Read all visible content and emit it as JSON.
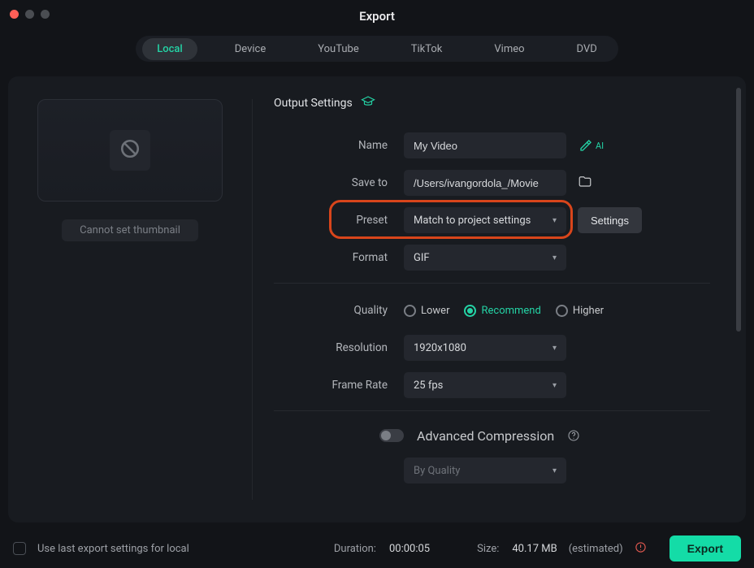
{
  "window": {
    "title": "Export"
  },
  "tabs": {
    "items": [
      {
        "label": "Local",
        "active": true
      },
      {
        "label": "Device"
      },
      {
        "label": "YouTube"
      },
      {
        "label": "TikTok"
      },
      {
        "label": "Vimeo"
      },
      {
        "label": "DVD"
      }
    ]
  },
  "left": {
    "thumbnail_caption": "Cannot set thumbnail"
  },
  "output": {
    "section_title": "Output Settings",
    "name_label": "Name",
    "name_value": "My Video",
    "saveto_label": "Save to",
    "saveto_value": "/Users/ivangordola_/Movie",
    "preset_label": "Preset",
    "preset_value": "Match to project settings",
    "settings_button": "Settings",
    "format_label": "Format",
    "format_value": "GIF",
    "quality_label": "Quality",
    "quality_options": {
      "lower": "Lower",
      "recommend": "Recommend",
      "higher": "Higher"
    },
    "quality_selected": "recommend",
    "resolution_label": "Resolution",
    "resolution_value": "1920x1080",
    "framerate_label": "Frame Rate",
    "framerate_value": "25 fps",
    "adv_label": "Advanced Compression",
    "byquality_value": "By Quality"
  },
  "footer": {
    "checkbox_label": "Use last export settings for local",
    "duration_label": "Duration:",
    "duration_value": "00:00:05",
    "size_label": "Size:",
    "size_value": "40.17 MB",
    "size_suffix": "(estimated)",
    "export_button": "Export"
  },
  "colors": {
    "accent": "#24d3a5",
    "highlight": "#d8451b"
  }
}
